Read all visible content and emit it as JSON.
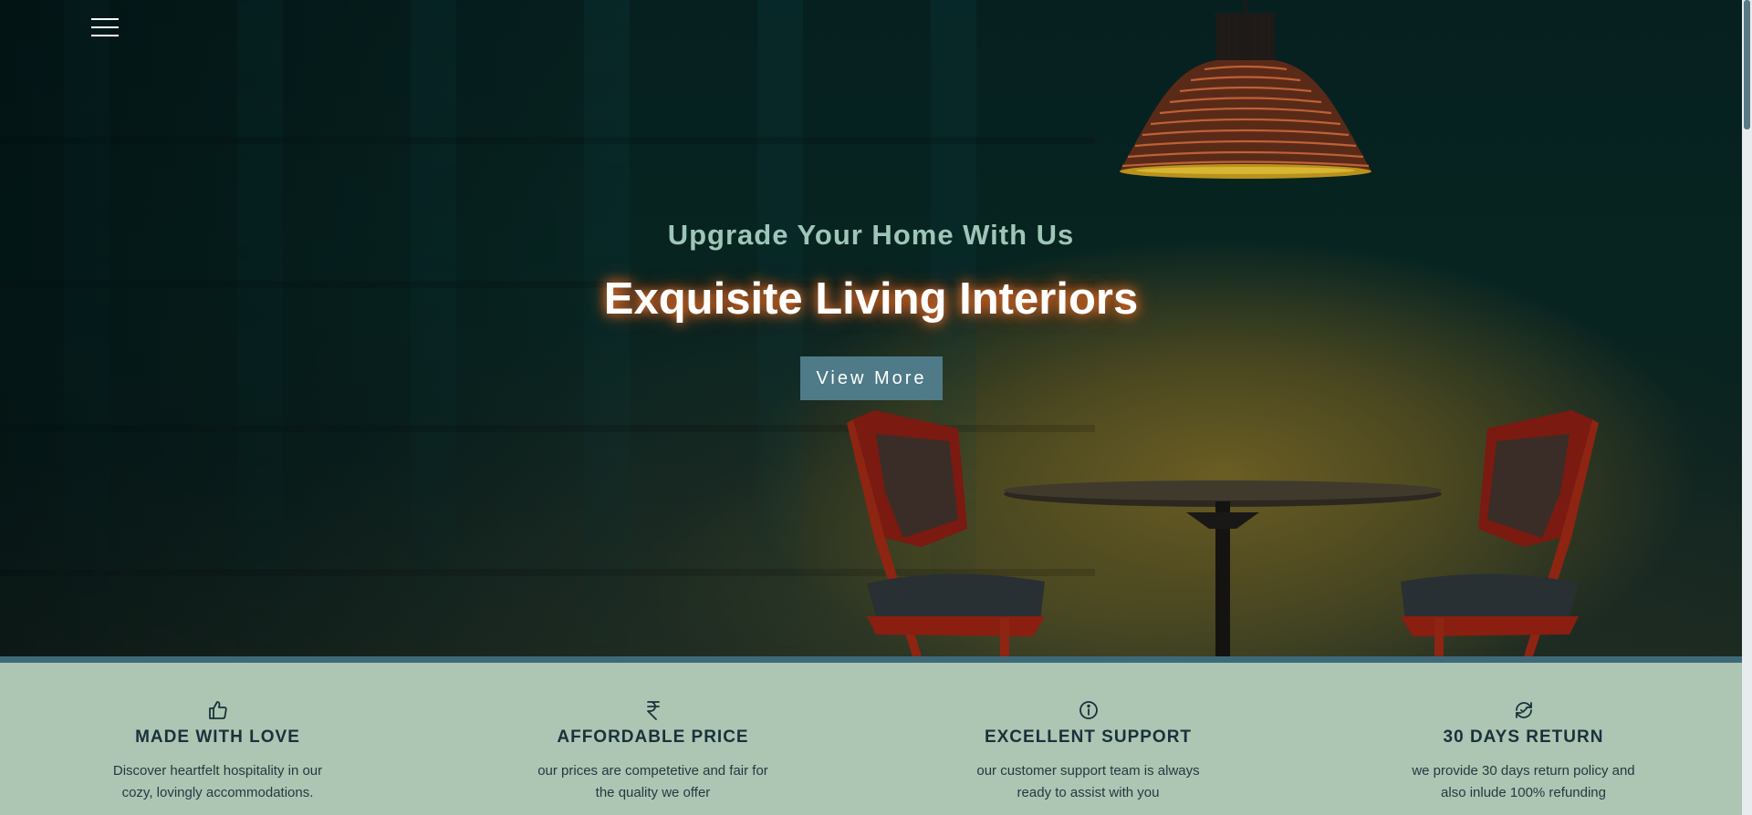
{
  "hero": {
    "subtitle": "Upgrade Your Home With Us",
    "title": "Exquisite Living Interiors",
    "cta_label": "View More",
    "menu_icon": "hamburger-menu-icon"
  },
  "features": [
    {
      "icon": "thumbs-up-icon",
      "title": "MADE WITH LOVE",
      "description": "Discover heartfelt hospitality in our cozy, lovingly accommodations."
    },
    {
      "icon": "rupee-icon",
      "title": "AFFORDABLE PRICE",
      "description": "our prices are competetive and fair for the quality we offer"
    },
    {
      "icon": "info-circle-icon",
      "title": "EXCELLENT SUPPORT",
      "description": "our customer support team is always ready to assist with you"
    },
    {
      "icon": "return-arrows-icon",
      "title": "30 DAYS RETURN",
      "description": "we provide 30 days return policy and also inlude 100% refunding"
    }
  ],
  "colors": {
    "accent": "#4f7a88",
    "features_bg": "#adc5b3",
    "heading": "#17323a",
    "subtitle": "#9ec6b6"
  }
}
